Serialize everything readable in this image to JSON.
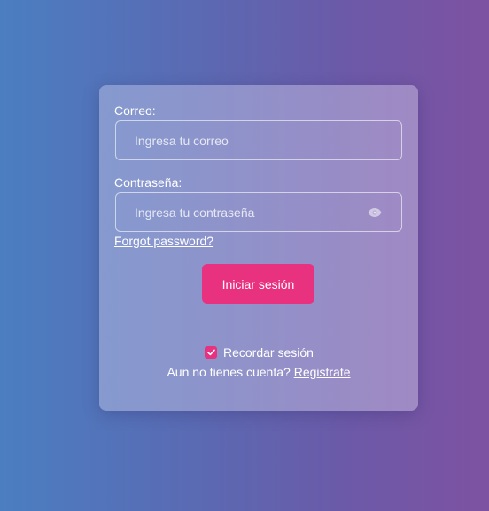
{
  "form": {
    "email_label": "Correo:",
    "email_placeholder": "Ingresa tu correo",
    "email_value": "",
    "password_label": "Contraseña:",
    "password_placeholder": "Ingresa tu contraseña",
    "password_value": "",
    "password_toggle_icon": "eye-icon",
    "forgot_link": "Forgot password?",
    "submit_label": "Iniciar sesión",
    "remember_checked": true,
    "remember_label": "Recordar sesión",
    "signup_prompt": "Aun no tienes cuenta?",
    "signup_link": "Registrate"
  },
  "colors": {
    "accent": "#e8317f",
    "background_start": "#4b7ec1",
    "background_end": "#7e52a2"
  }
}
